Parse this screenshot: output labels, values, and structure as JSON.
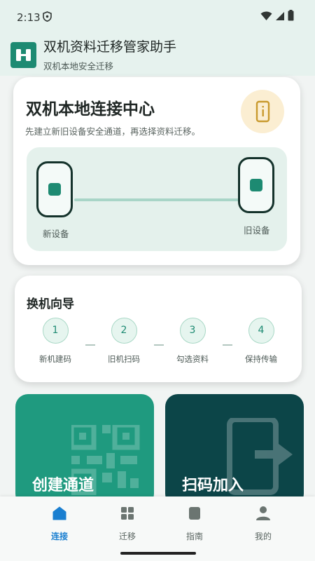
{
  "status": {
    "time": "2:13"
  },
  "app": {
    "title": "双机资料迁移管家助手",
    "subtitle": "双机本地安全迁移"
  },
  "hero": {
    "title": "双机本地连接中心",
    "description": "先建立新旧设备安全通道，再选择资料迁移。",
    "new_device_label": "新设备",
    "old_device_label": "旧设备"
  },
  "guide": {
    "title": "换机向导",
    "steps": [
      {
        "number": "1",
        "label": "新机建码"
      },
      {
        "number": "2",
        "label": "旧机扫码"
      },
      {
        "number": "3",
        "label": "勾选资料"
      },
      {
        "number": "4",
        "label": "保持传输"
      }
    ]
  },
  "actions": {
    "create": "创建通道",
    "scan": "扫码加入"
  },
  "nav": {
    "items": [
      {
        "label": "连接",
        "icon": "home-icon",
        "active": true
      },
      {
        "label": "迁移",
        "icon": "grid-icon",
        "active": false
      },
      {
        "label": "指南",
        "icon": "guide-icon",
        "active": false
      },
      {
        "label": "我的",
        "icon": "person-icon",
        "active": false
      }
    ]
  },
  "colors": {
    "primary": "#1d8a72",
    "dark": "#0c4548",
    "accent_nav": "#1a7fd0"
  }
}
